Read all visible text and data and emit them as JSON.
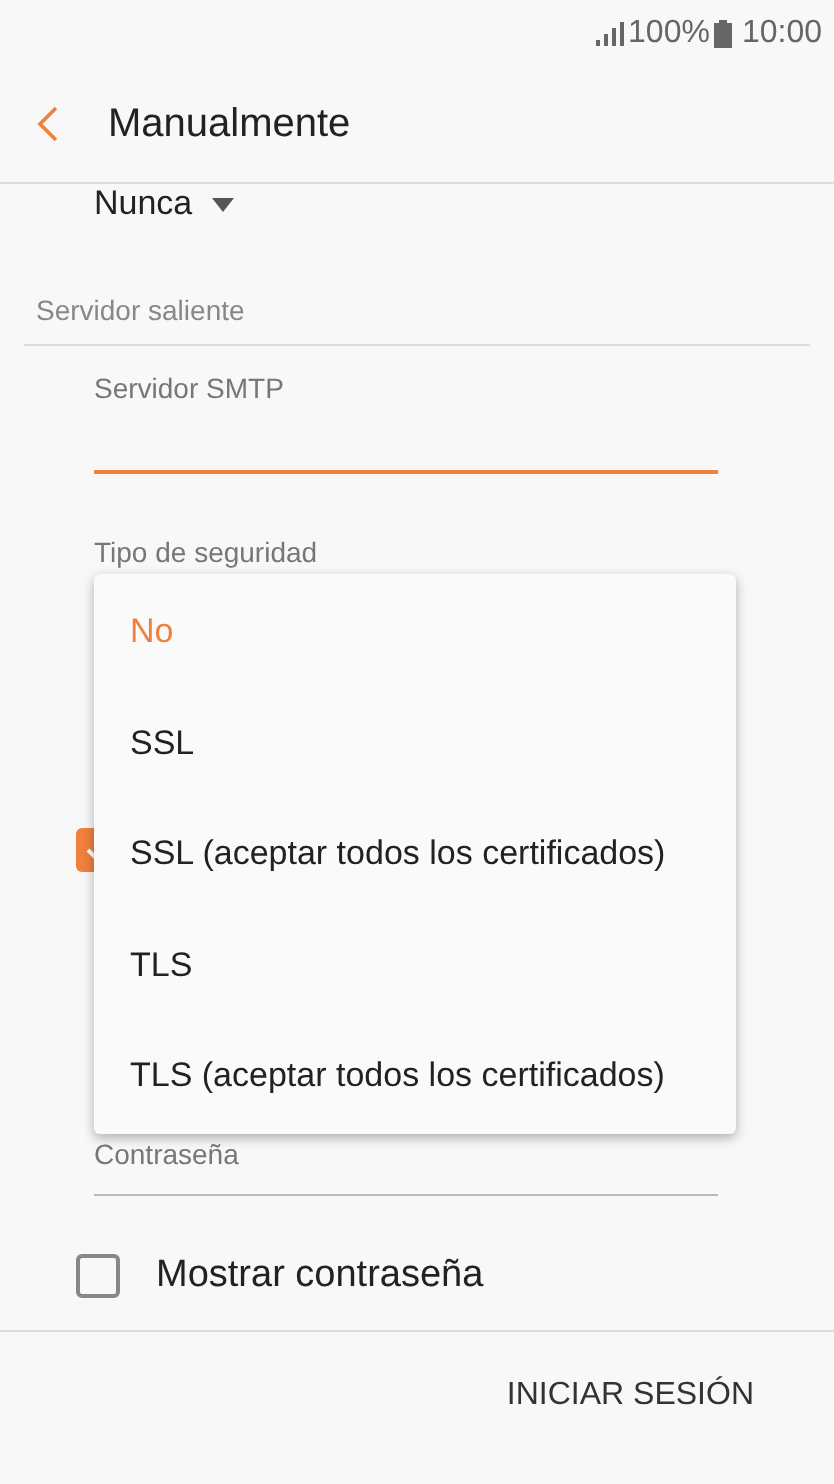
{
  "status_bar": {
    "battery": "100%",
    "time": "10:00"
  },
  "header": {
    "title": "Manualmente"
  },
  "sync_value": {
    "value": "Nunca"
  },
  "section": {
    "title": "Servidor saliente"
  },
  "smtp_field": {
    "label": "Servidor SMTP",
    "focused": true
  },
  "security": {
    "label": "Tipo de seguridad"
  },
  "auth_checkbox": {
    "checked": true
  },
  "password_field": {
    "label": "Contraseña"
  },
  "show_password": {
    "label": "Mostrar contraseña",
    "checked": false
  },
  "menu": [
    {
      "label": "No",
      "selected": true
    },
    {
      "label": "SSL",
      "selected": false
    },
    {
      "label": "SSL (aceptar todos los certificados)",
      "selected": false
    },
    {
      "label": "TLS",
      "selected": false
    },
    {
      "label": "TLS (aceptar todos los certificados)",
      "selected": false
    }
  ],
  "action": {
    "label": "INICIAR SESIÓN"
  }
}
